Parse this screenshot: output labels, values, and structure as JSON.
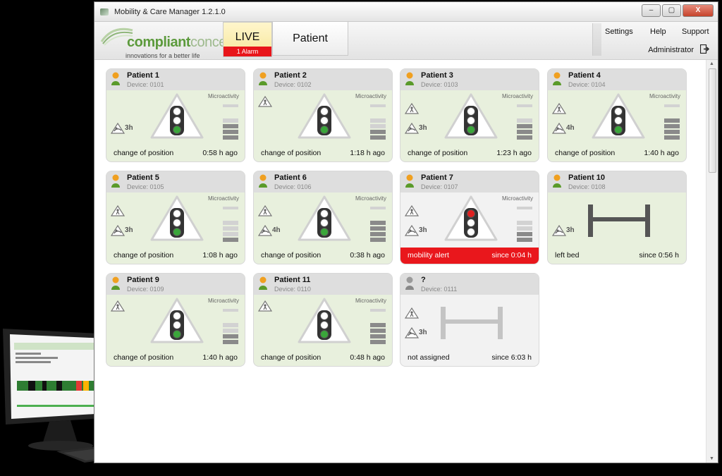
{
  "window": {
    "title": "Mobility & Care Manager 1.2.1.0",
    "controls": [
      "–",
      "▢",
      "X"
    ]
  },
  "header": {
    "logo": {
      "brand_main": "compliant",
      "brand_secondary": "concept",
      "tagline": "innovations for a better life"
    },
    "tabs": {
      "live": "LIVE",
      "live_alarm": "1 Alarm",
      "patient": "Patient"
    },
    "menu": {
      "settings": "Settings",
      "help": "Help",
      "support": "Support"
    },
    "user": "Administrator"
  },
  "colors": {
    "accent_green": "#5c9a3c",
    "alert_red": "#e9171c",
    "tile_green": "#e8f0dd",
    "live_yellow": "#f6e69a"
  },
  "common": {
    "microactivity": "Microactivity"
  },
  "patients": [
    {
      "name": "Patient 1",
      "device": "Device: 0101",
      "status": "change of position",
      "time": "0:58 h ago",
      "hours": "3h",
      "light": "green",
      "level": 3,
      "icons": [
        "turn"
      ],
      "type": "traffic"
    },
    {
      "name": "Patient 2",
      "device": "Device: 0102",
      "status": "change of position",
      "time": "1:18 h ago",
      "hours": "",
      "light": "green",
      "level": 2,
      "icons": [
        "warn"
      ],
      "type": "traffic"
    },
    {
      "name": "Patient 3",
      "device": "Device: 0103",
      "status": "change of position",
      "time": "1:23 h ago",
      "hours": "3h",
      "light": "green",
      "level": 3,
      "icons": [
        "warn",
        "turn"
      ],
      "type": "traffic"
    },
    {
      "name": "Patient 4",
      "device": "Device: 0104",
      "status": "change of position",
      "time": "1:40 h ago",
      "hours": "4h",
      "light": "green",
      "level": 4,
      "icons": [
        "warn",
        "turn"
      ],
      "type": "traffic"
    },
    {
      "name": "Patient 5",
      "device": "Device: 0105",
      "status": "change of position",
      "time": "1:08 h ago",
      "hours": "3h",
      "light": "green",
      "level": 1,
      "icons": [
        "warn",
        "turn"
      ],
      "type": "traffic"
    },
    {
      "name": "Patient 6",
      "device": "Device: 0106",
      "status": "change of position",
      "time": "0:38 h ago",
      "hours": "4h",
      "light": "green",
      "level": 4,
      "icons": [
        "warn",
        "turn"
      ],
      "type": "traffic"
    },
    {
      "name": "Patient 7",
      "device": "Device: 0107",
      "status": "mobility alert",
      "time": "since 0:04 h",
      "hours": "3h",
      "light": "red",
      "level": 2,
      "icons": [
        "warn",
        "turn"
      ],
      "type": "alert"
    },
    {
      "name": "Patient 10",
      "device": "Device: 0108",
      "status": "left bed",
      "time": "since 0:56 h",
      "hours": "3h",
      "light": "",
      "level": 0,
      "icons": [
        "turn"
      ],
      "type": "bed"
    },
    {
      "name": "Patient 9",
      "device": "Device: 0109",
      "status": "change of position",
      "time": "1:40 h ago",
      "hours": "",
      "light": "green",
      "level": 2,
      "icons": [
        "warn"
      ],
      "type": "traffic"
    },
    {
      "name": "Patient 11",
      "device": "Device: 0110",
      "status": "change of position",
      "time": "0:48 h ago",
      "hours": "",
      "light": "green",
      "level": 4,
      "icons": [
        "warn"
      ],
      "type": "traffic"
    },
    {
      "name": "?",
      "device": "Device: 0111",
      "status": "not assigned",
      "time": "since 6:03 h",
      "hours": "3h",
      "light": "",
      "level": 0,
      "icons": [
        "warn",
        "turn"
      ],
      "type": "unassigned"
    }
  ]
}
